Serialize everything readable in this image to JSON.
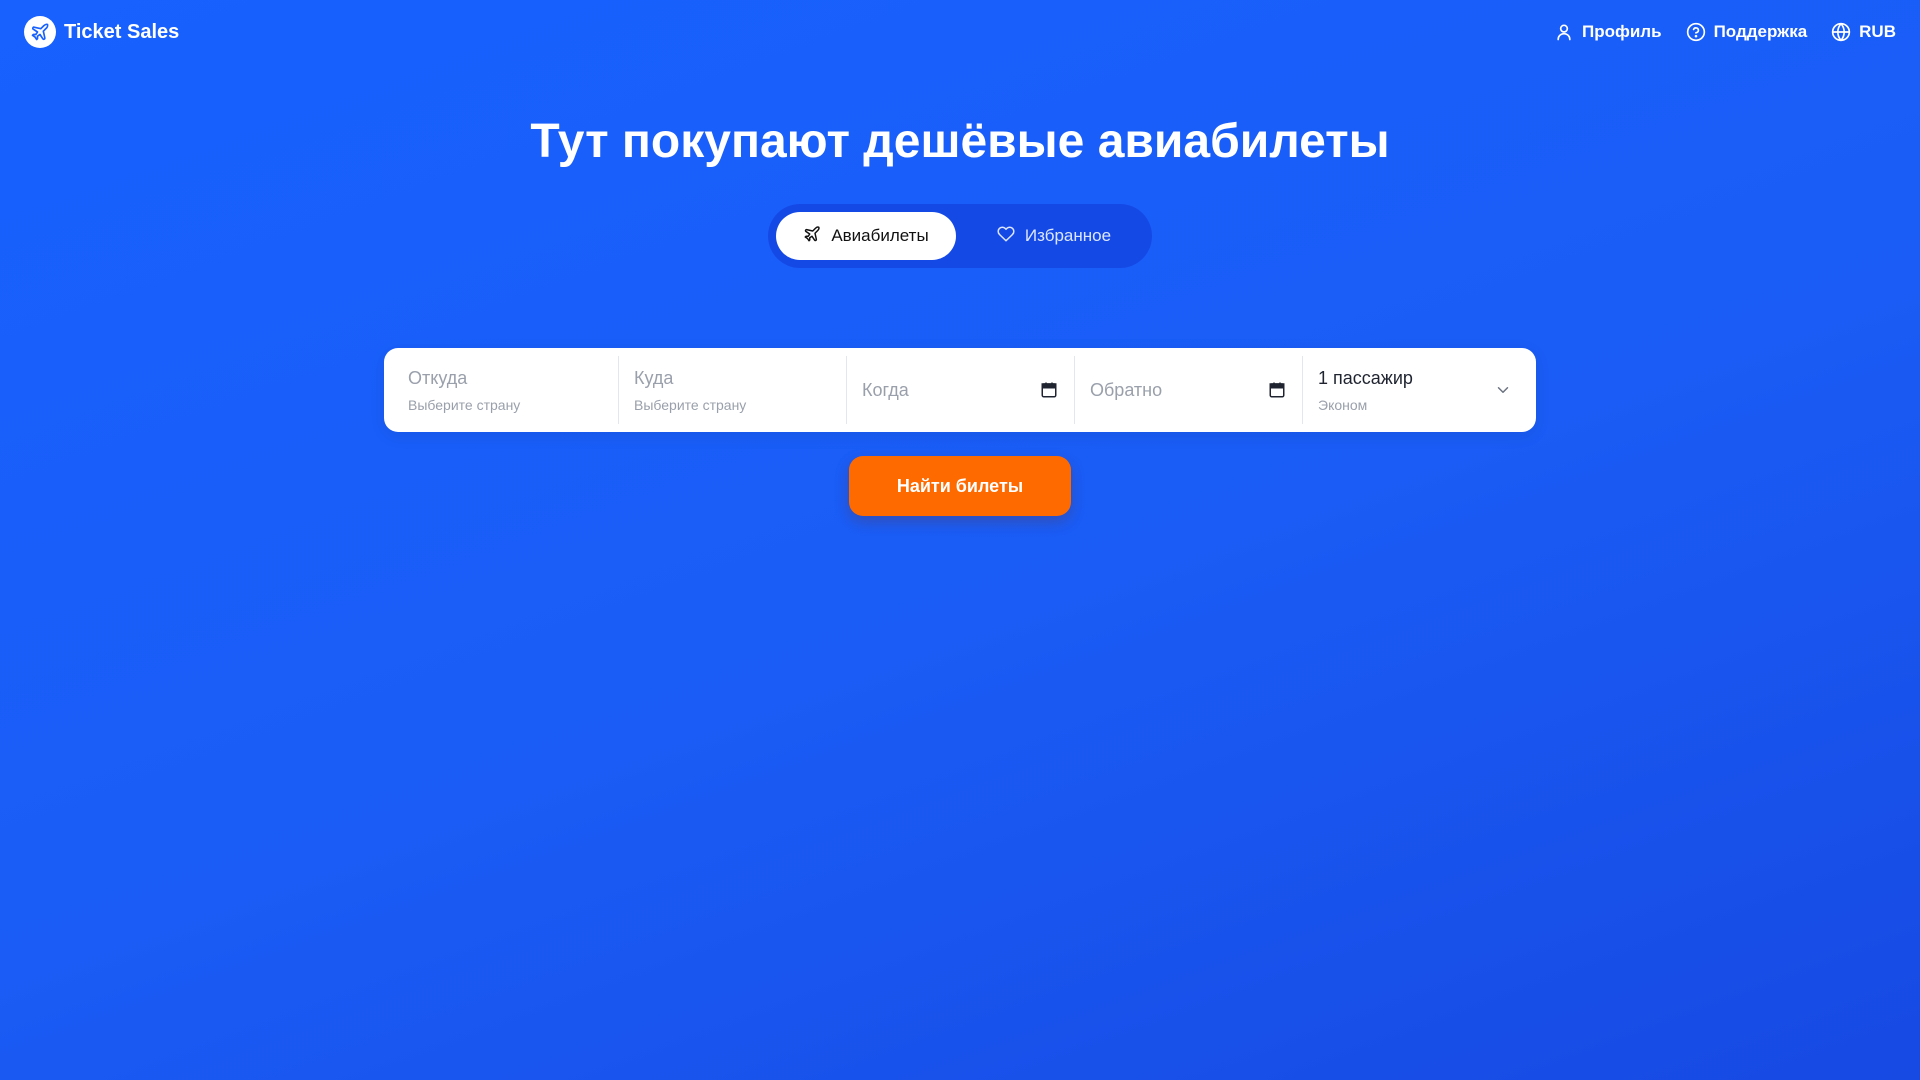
{
  "brand": {
    "name": "Ticket Sales",
    "icon": "airplane-icon"
  },
  "nav": {
    "profile": {
      "label": "Профиль",
      "icon": "user-icon"
    },
    "support": {
      "label": "Поддержка",
      "icon": "help-circle-icon"
    },
    "currency": {
      "label": "RUB",
      "icon": "globe-icon"
    }
  },
  "hero": {
    "title": "Тут покупают дешёвые авиабилеты"
  },
  "mode_tabs": [
    {
      "label": "Авиабилеты",
      "icon": "airplane-icon",
      "active": true
    },
    {
      "label": "Избранное",
      "icon": "heart-icon",
      "active": false
    }
  ],
  "search": {
    "from": {
      "placeholder": "Откуда",
      "hint": "Выберите страну"
    },
    "to": {
      "placeholder": "Куда",
      "hint": "Выберите страну"
    },
    "depart": {
      "placeholder": "Когда",
      "icon": "calendar-icon"
    },
    "return": {
      "placeholder": "Обратно",
      "icon": "calendar-icon"
    },
    "passengers": {
      "value": "1 пассажир",
      "class": "Эконом",
      "icon": "chevron-down-icon"
    }
  },
  "submit": {
    "label": "Найти билеты"
  },
  "colors": {
    "background": "#1a5cf5",
    "toggle_bg": "#1549e6",
    "accent": "#ff6a00",
    "card": "#ffffff",
    "muted_text": "#9aa0ab"
  }
}
